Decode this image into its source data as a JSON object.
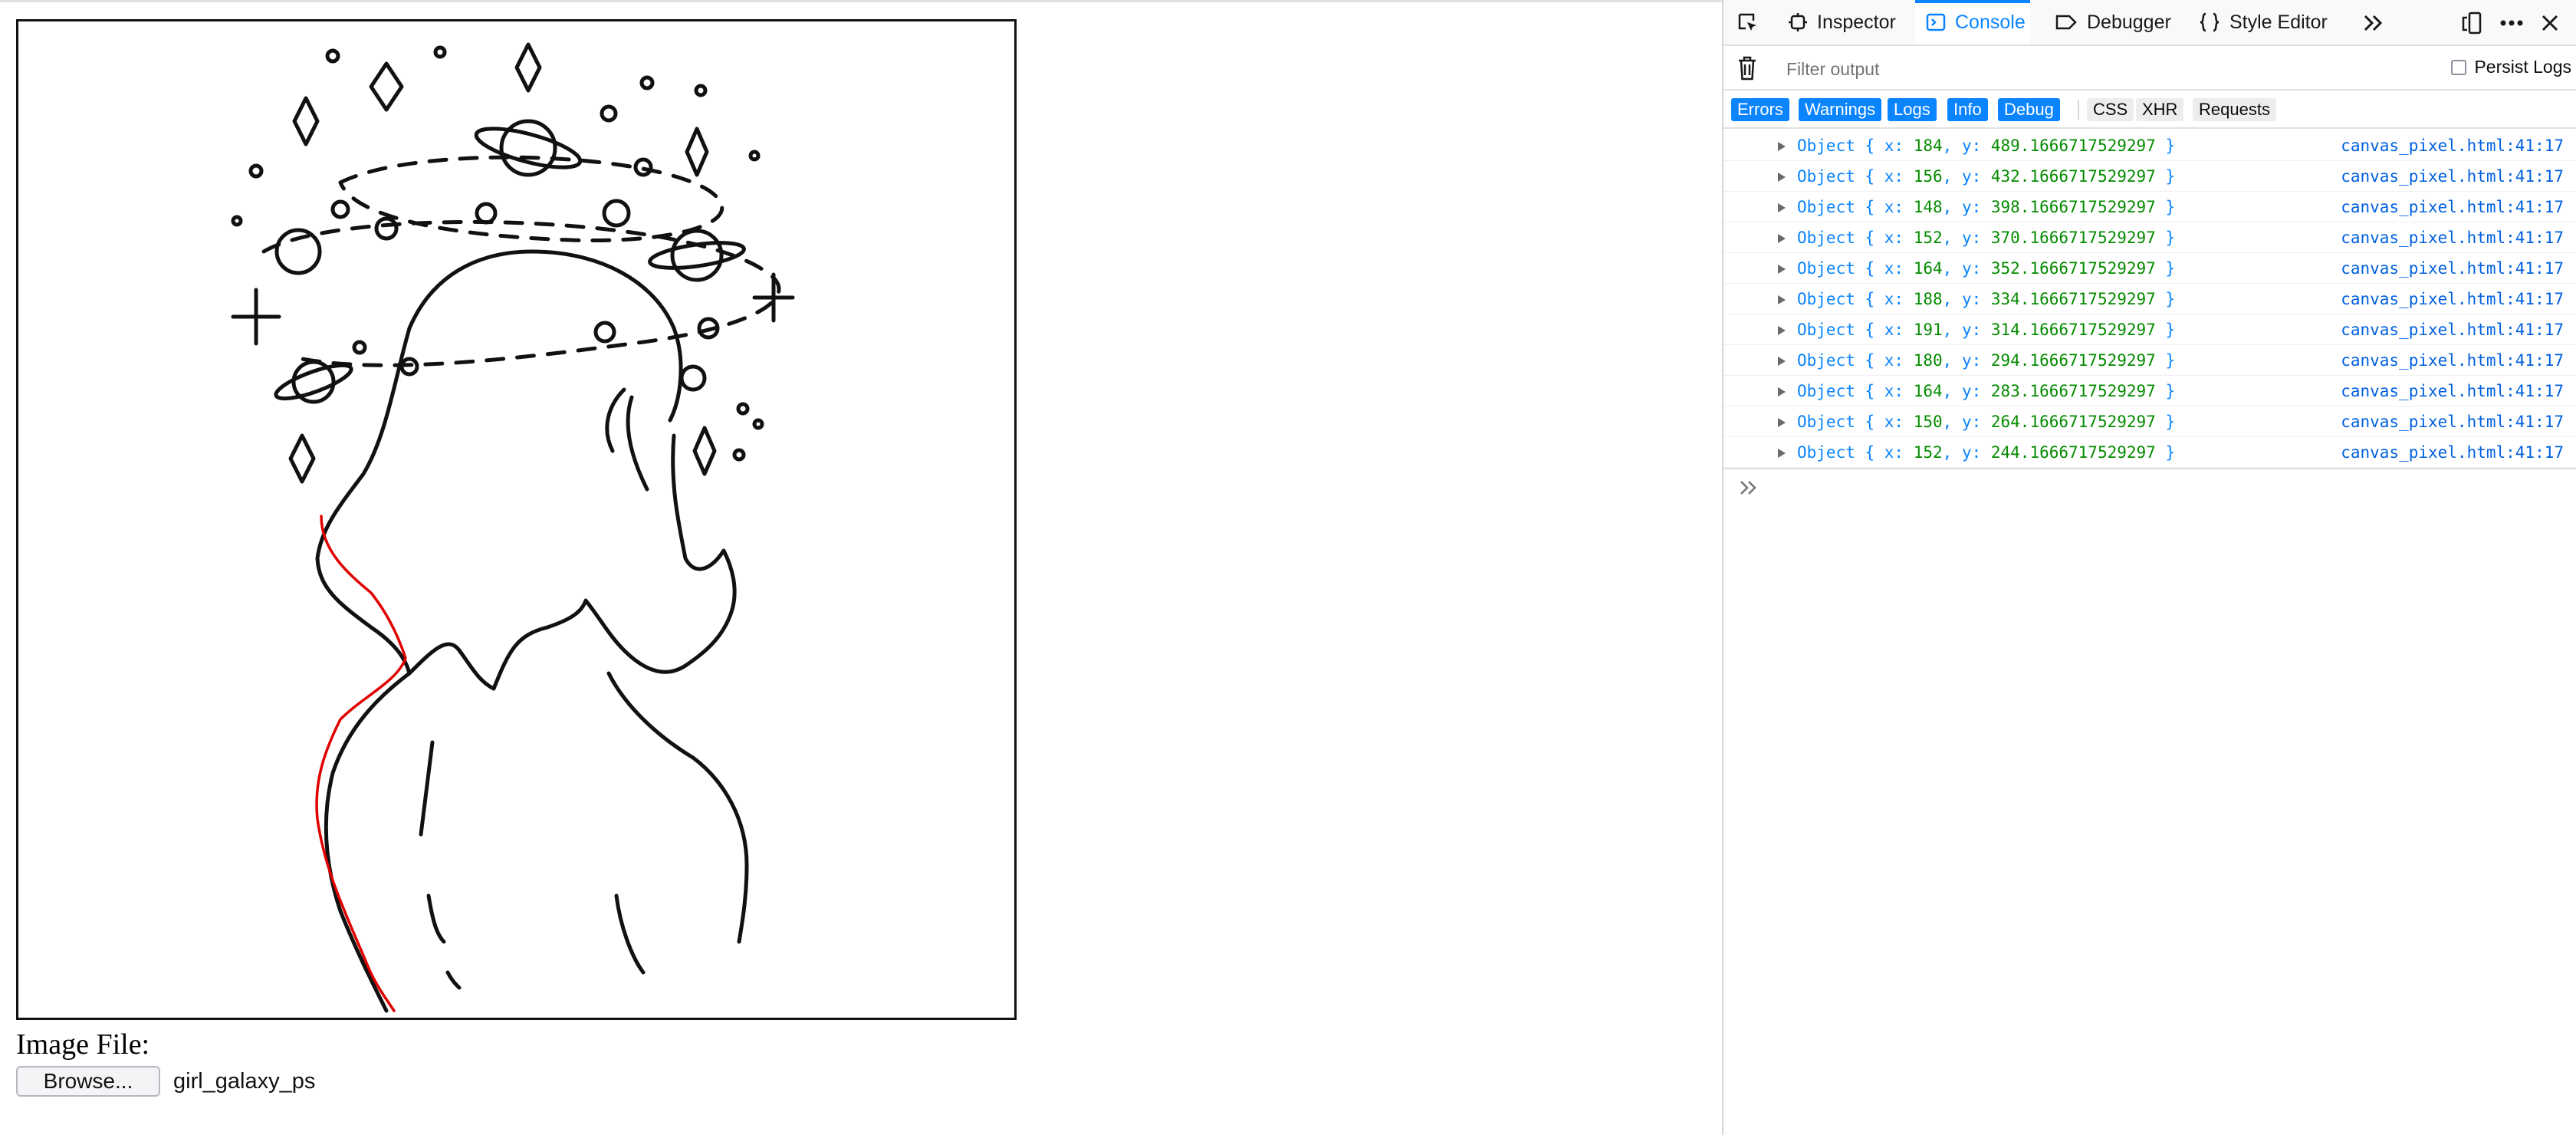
{
  "page": {
    "image_file_label": "Image File:",
    "browse_label": "Browse...",
    "file_name": "girl_galaxy_ps"
  },
  "devtools": {
    "tabs": [
      {
        "label": "Inspector",
        "icon": "inspector-icon"
      },
      {
        "label": "Console",
        "icon": "console-icon",
        "selected": true
      },
      {
        "label": "Debugger",
        "icon": "debugger-icon"
      },
      {
        "label": "Style Editor",
        "icon": "style-editor-icon"
      }
    ],
    "filter_placeholder": "Filter output",
    "persist_logs_label": "Persist Logs",
    "levels": [
      {
        "label": "Errors",
        "active": true
      },
      {
        "label": "Warnings",
        "active": true
      },
      {
        "label": "Logs",
        "active": true
      },
      {
        "label": "Info",
        "active": true
      },
      {
        "label": "Debug",
        "active": true
      },
      {
        "label": "CSS",
        "active": false
      },
      {
        "label": "XHR",
        "active": false
      },
      {
        "label": "Requests",
        "active": false
      }
    ],
    "accent_color": "#0a84ff",
    "logs": [
      {
        "prefix": "Object { x: ",
        "x": "184",
        "mid": ", y: ",
        "y": "489.1666717529297",
        "suffix": " }",
        "source": "canvas_pixel.html:41:17"
      },
      {
        "prefix": "Object { x: ",
        "x": "156",
        "mid": ", y: ",
        "y": "432.1666717529297",
        "suffix": " }",
        "source": "canvas_pixel.html:41:17"
      },
      {
        "prefix": "Object { x: ",
        "x": "148",
        "mid": ", y: ",
        "y": "398.1666717529297",
        "suffix": " }",
        "source": "canvas_pixel.html:41:17"
      },
      {
        "prefix": "Object { x: ",
        "x": "152",
        "mid": ", y: ",
        "y": "370.1666717529297",
        "suffix": " }",
        "source": "canvas_pixel.html:41:17"
      },
      {
        "prefix": "Object { x: ",
        "x": "164",
        "mid": ", y: ",
        "y": "352.1666717529297",
        "suffix": " }",
        "source": "canvas_pixel.html:41:17"
      },
      {
        "prefix": "Object { x: ",
        "x": "188",
        "mid": ", y: ",
        "y": "334.1666717529297",
        "suffix": " }",
        "source": "canvas_pixel.html:41:17"
      },
      {
        "prefix": "Object { x: ",
        "x": "191",
        "mid": ", y: ",
        "y": "314.1666717529297",
        "suffix": " }",
        "source": "canvas_pixel.html:41:17"
      },
      {
        "prefix": "Object { x: ",
        "x": "180",
        "mid": ", y: ",
        "y": "294.1666717529297",
        "suffix": " }",
        "source": "canvas_pixel.html:41:17"
      },
      {
        "prefix": "Object { x: ",
        "x": "164",
        "mid": ", y: ",
        "y": "283.1666717529297",
        "suffix": " }",
        "source": "canvas_pixel.html:41:17"
      },
      {
        "prefix": "Object { x: ",
        "x": "150",
        "mid": ", y: ",
        "y": "264.1666717529297",
        "suffix": " }",
        "source": "canvas_pixel.html:41:17"
      },
      {
        "prefix": "Object { x: ",
        "x": "152",
        "mid": ", y: ",
        "y": "244.1666717529297",
        "suffix": " }",
        "source": "canvas_pixel.html:41:17"
      }
    ]
  }
}
